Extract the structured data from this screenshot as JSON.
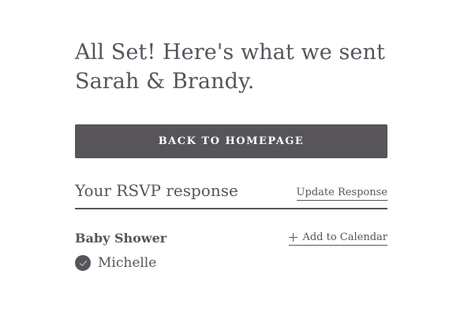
{
  "heading": "All Set! Here's what we sent Sarah & Brandy.",
  "back_button_label": "BACK TO HOMEPAGE",
  "rsvp": {
    "title": "Your RSVP response",
    "update_label": "Update Response"
  },
  "event": {
    "name": "Baby Shower",
    "calendar_label": "Add to Calendar",
    "calendar_icon": "plus-icon"
  },
  "guest": {
    "name": "Michelle",
    "status_icon": "check-circle-icon"
  },
  "colors": {
    "text": "#57545c",
    "button_bg": "#57545a",
    "button_text": "#ffffff",
    "background": "#ffffff"
  }
}
